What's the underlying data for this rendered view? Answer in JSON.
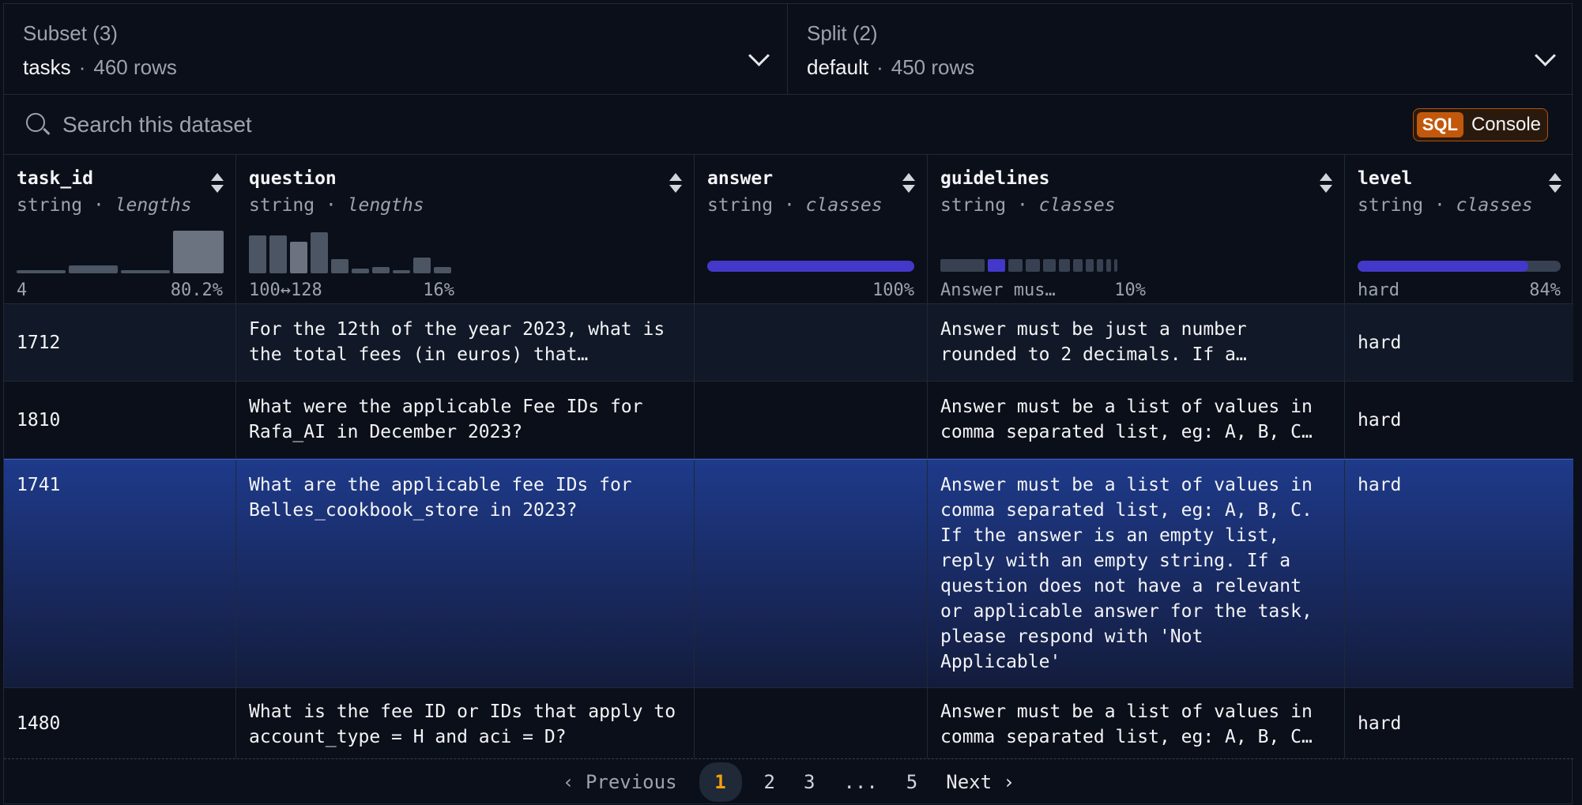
{
  "subset": {
    "label": "Subset (3)",
    "value": "tasks",
    "rows": "460 rows"
  },
  "split": {
    "label": "Split (2)",
    "value": "default",
    "rows": "450 rows"
  },
  "search": {
    "placeholder": "Search this dataset"
  },
  "sql_console": {
    "tag": "SQL",
    "label": "Console"
  },
  "columns": [
    {
      "name": "task_id",
      "type": "string",
      "kind": "lengths",
      "stat_left": "4",
      "stat_right": "80.2%"
    },
    {
      "name": "question",
      "type": "string",
      "kind": "lengths",
      "stat_left": "100↔128",
      "stat_right": "16%"
    },
    {
      "name": "answer",
      "type": "string",
      "kind": "classes",
      "stat_left": "",
      "stat_right": "100%",
      "fill": 1.0
    },
    {
      "name": "guidelines",
      "type": "string",
      "kind": "classes",
      "stat_left": "Answer mus…",
      "stat_right": "10%"
    },
    {
      "name": "level",
      "type": "string",
      "kind": "classes",
      "stat_left": "hard",
      "stat_right": "84%",
      "fill": 0.84
    }
  ],
  "rows": [
    {
      "task_id": "1712",
      "question": "For the 12th of the year 2023, what is the total fees (in euros) that…",
      "answer": "",
      "guidelines": "Answer must be just a number rounded to 2 decimals. If a…",
      "level": "hard"
    },
    {
      "task_id": "1810",
      "question": "What were the applicable Fee IDs for Rafa_AI in December 2023?",
      "answer": "",
      "guidelines": "Answer must be a list of values in comma separated list, eg: A, B, C…",
      "level": "hard"
    },
    {
      "task_id": "1741",
      "question": "What are the applicable fee IDs for Belles_cookbook_store in 2023?",
      "answer": "",
      "guidelines": "Answer must be a list of values in comma separated list, eg: A, B, C. If the answer is an empty list, reply with an empty string. If a question does not have a relevant or applicable answer for the task, please respond with 'Not Applicable'",
      "level": "hard"
    },
    {
      "task_id": "1480",
      "question": "What is the fee ID or IDs that apply to account_type = H and aci = D?",
      "answer": "",
      "guidelines": "Answer must be a list of values in comma separated list, eg: A, B, C…",
      "level": "hard"
    }
  ],
  "pagination": {
    "previous": "Previous",
    "pages": [
      "1",
      "2",
      "3",
      "...",
      "5"
    ],
    "current": "1",
    "next": "Next"
  },
  "colors": {
    "accent": "#4338ca",
    "current_page": "#f59e0b",
    "sql_tag": "#c2580c",
    "selected_row": "#1e3a8a"
  }
}
